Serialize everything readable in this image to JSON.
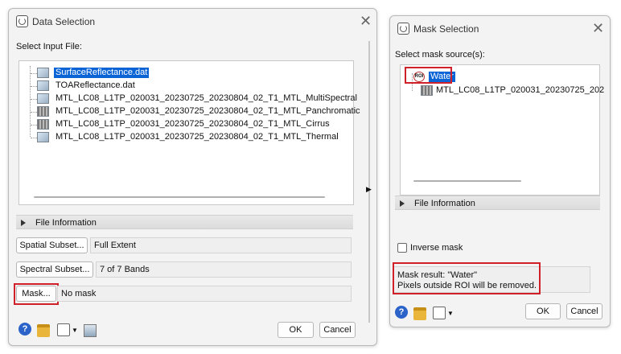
{
  "data_dialog": {
    "title": "Data Selection",
    "input_label": "Select Input File:",
    "files": [
      {
        "name": "SurfaceReflectance.dat",
        "selected": true,
        "icon": "raster-icon"
      },
      {
        "name": "TOAReflectance.dat",
        "selected": false,
        "icon": "raster-icon"
      },
      {
        "name": "MTL_LC08_L1TP_020031_20230725_20230804_02_T1_MTL_MultiSpectral",
        "selected": false,
        "icon": "raster-icon"
      },
      {
        "name": "MTL_LC08_L1TP_020031_20230725_20230804_02_T1_MTL_Panchromatic",
        "selected": false,
        "icon": "grayscale-raster-icon"
      },
      {
        "name": "MTL_LC08_L1TP_020031_20230725_20230804_02_T1_MTL_Cirrus",
        "selected": false,
        "icon": "grayscale-raster-icon"
      },
      {
        "name": "MTL_LC08_L1TP_020031_20230725_20230804_02_T1_MTL_Thermal",
        "selected": false,
        "icon": "raster-icon"
      }
    ],
    "file_info_label": "File Information",
    "spatial_subset_button": "Spatial Subset...",
    "spatial_subset_value": "Full Extent",
    "spectral_subset_button": "Spectral Subset...",
    "spectral_subset_value": "7 of 7 Bands",
    "mask_button": "Mask...",
    "mask_value": "No mask",
    "ok_button": "OK",
    "cancel_button": "Cancel",
    "help_glyph": "?"
  },
  "mask_dialog": {
    "title": "Mask Selection",
    "source_label": "Select mask source(s):",
    "sources": [
      {
        "name": "Water",
        "selected": true,
        "icon": "roi-icon"
      },
      {
        "name": "MTL_LC08_L1TP_020031_20230725_202",
        "selected": false,
        "icon": "raster-icon"
      }
    ],
    "roi_glyph": "ROI",
    "file_info_label": "File Information",
    "inverse_mask_label": "Inverse mask",
    "inverse_mask_checked": false,
    "result_line1": "Mask result: \"Water\"",
    "result_line2": "Pixels outside ROI will be removed.",
    "ok_button": "OK",
    "cancel_button": "Cancel",
    "help_glyph": "?"
  },
  "close_glyph": "✕",
  "colors": {
    "selection": "#0a64d6",
    "highlight_box": "#d0202a",
    "dialog_bg": "#f3f3f3"
  }
}
